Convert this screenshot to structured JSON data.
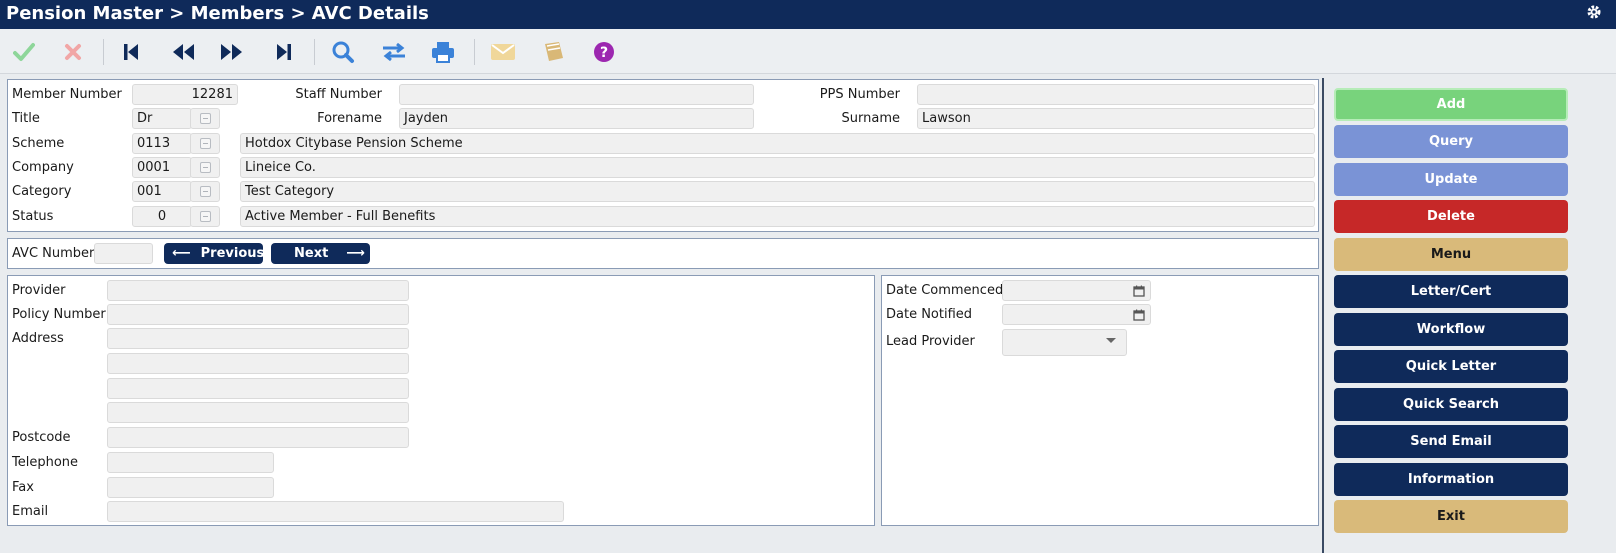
{
  "header": {
    "title": "Pension Master > Members > AVC Details",
    "settings_icon": "gear-icon"
  },
  "toolbar": {
    "icons": [
      "check-icon",
      "cancel-icon",
      "first-record-icon",
      "previous-record-icon",
      "next-record-icon",
      "last-record-icon",
      "search-icon",
      "transfer-icon",
      "print-icon",
      "email-icon",
      "notebook-icon",
      "help-icon"
    ]
  },
  "member": {
    "member_number_label": "Member Number",
    "member_number": "12281",
    "staff_number_label": "Staff Number",
    "staff_number": "",
    "pps_number_label": "PPS Number",
    "pps_number": "",
    "title_label": "Title",
    "title": "Dr",
    "forename_label": "Forename",
    "forename": "Jayden",
    "surname_label": "Surname",
    "surname": "Lawson",
    "scheme_label": "Scheme",
    "scheme_code": "0113",
    "scheme_name": "Hotdox Citybase Pension Scheme",
    "company_label": "Company",
    "company_code": "0001",
    "company_name": "Lineice Co.",
    "category_label": "Category",
    "category_code": "001",
    "category_name": "Test Category",
    "status_label": "Status",
    "status_code": "0",
    "status_name": "Active Member - Full Benefits"
  },
  "avc": {
    "number_label": "AVC Number",
    "number": "",
    "previous_label": "Previous",
    "next_label": "Next"
  },
  "details": {
    "provider_label": "Provider",
    "provider": "",
    "policy_label": "Policy Number",
    "policy": "",
    "address_label": "Address",
    "address": [
      "",
      "",
      "",
      ""
    ],
    "postcode_label": "Postcode",
    "postcode": "",
    "telephone_label": "Telephone",
    "telephone": "",
    "fax_label": "Fax",
    "fax": "",
    "email_label": "Email",
    "email": "",
    "date_commenced_label": "Date Commenced",
    "date_commenced": "",
    "date_notified_label": "Date Notified",
    "date_notified": "",
    "lead_provider_label": "Lead Provider",
    "lead_provider": ""
  },
  "sidebar": {
    "buttons": [
      "Add",
      "Query",
      "Update",
      "Delete",
      "Menu",
      "Letter/Cert",
      "Workflow",
      "Quick Letter",
      "Quick Search",
      "Send Email",
      "Information",
      "Exit"
    ]
  },
  "colors": {
    "navy": "#0f2a5a",
    "add": "#78d37c",
    "query": "#7a93d6",
    "delete": "#c62828",
    "tan": "#d9ba7a"
  }
}
